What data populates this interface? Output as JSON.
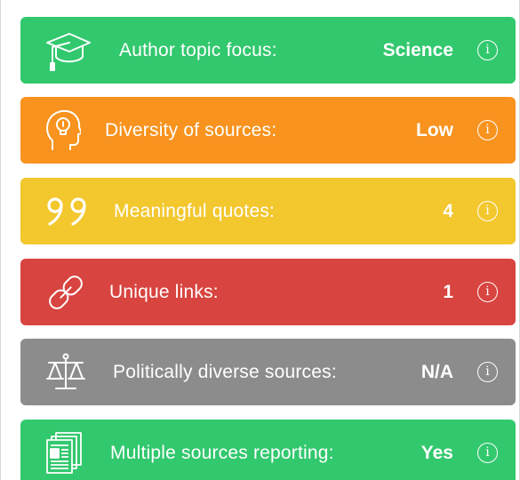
{
  "rows": [
    {
      "label": "Author topic focus:",
      "value": "Science",
      "icon": "graduation-cap-icon",
      "color": "#32c86e"
    },
    {
      "label": "Diversity of sources:",
      "value": "Low",
      "icon": "lightbulb-head-icon",
      "color": "#f7931e"
    },
    {
      "label": "Meaningful quotes:",
      "value": "4",
      "icon": "quote-icon",
      "color": "#f3c72e"
    },
    {
      "label": "Unique links:",
      "value": "1",
      "icon": "link-icon",
      "color": "#d8443f"
    },
    {
      "label": "Politically diverse sources:",
      "value": "N/A",
      "icon": "balance-scale-icon",
      "color": "#8c8c8c"
    },
    {
      "label": "Multiple sources reporting:",
      "value": "Yes",
      "icon": "newspaper-icon",
      "color": "#32c86e"
    }
  ],
  "info_glyph": "i"
}
